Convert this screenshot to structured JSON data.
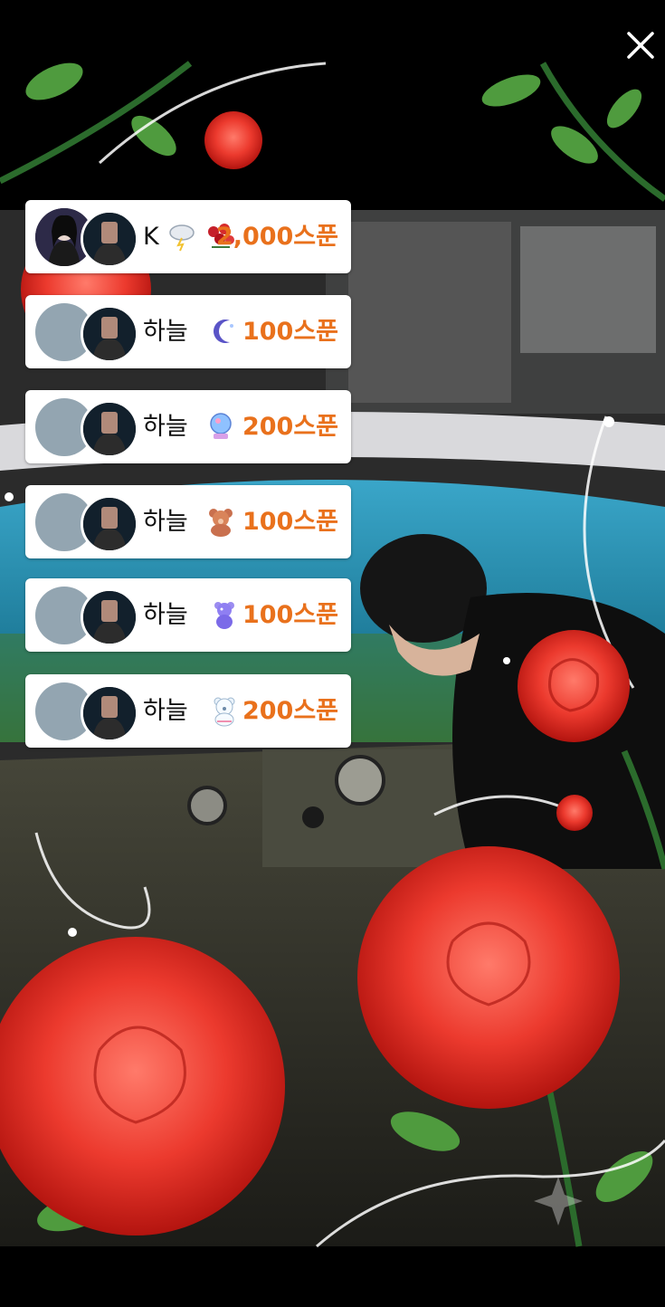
{
  "overlay": {
    "close_icon": "close-icon",
    "watermark_icon": "sparkle-star-icon"
  },
  "gifts": [
    {
      "sender": "K",
      "sender_badge": "storm-cloud-icon",
      "gift_icon": "rose-bouquet-icon",
      "amount": "2,000스푼",
      "sender_avatar": "profile-photo"
    },
    {
      "sender": "하늘",
      "gift_icon": "crescent-moon-icon",
      "amount": "100스푼",
      "sender_avatar": "default-avatar"
    },
    {
      "sender": "하늘",
      "gift_icon": "crystal-ball-icon",
      "amount": "200스푼",
      "sender_avatar": "default-avatar"
    },
    {
      "sender": "하늘",
      "gift_icon": "teddy-bear-icon",
      "amount": "100스푼",
      "sender_avatar": "default-avatar"
    },
    {
      "sender": "하늘",
      "gift_icon": "gummy-bear-icon",
      "amount": "100스푼",
      "sender_avatar": "default-avatar"
    },
    {
      "sender": "하늘",
      "gift_icon": "polar-bear-icon",
      "amount": "200스푼",
      "sender_avatar": "default-avatar"
    }
  ],
  "colors": {
    "amount": "#e9711c",
    "card": "#ffffff",
    "default_avatar": "#93a5b1",
    "rose": "#e8322c"
  }
}
